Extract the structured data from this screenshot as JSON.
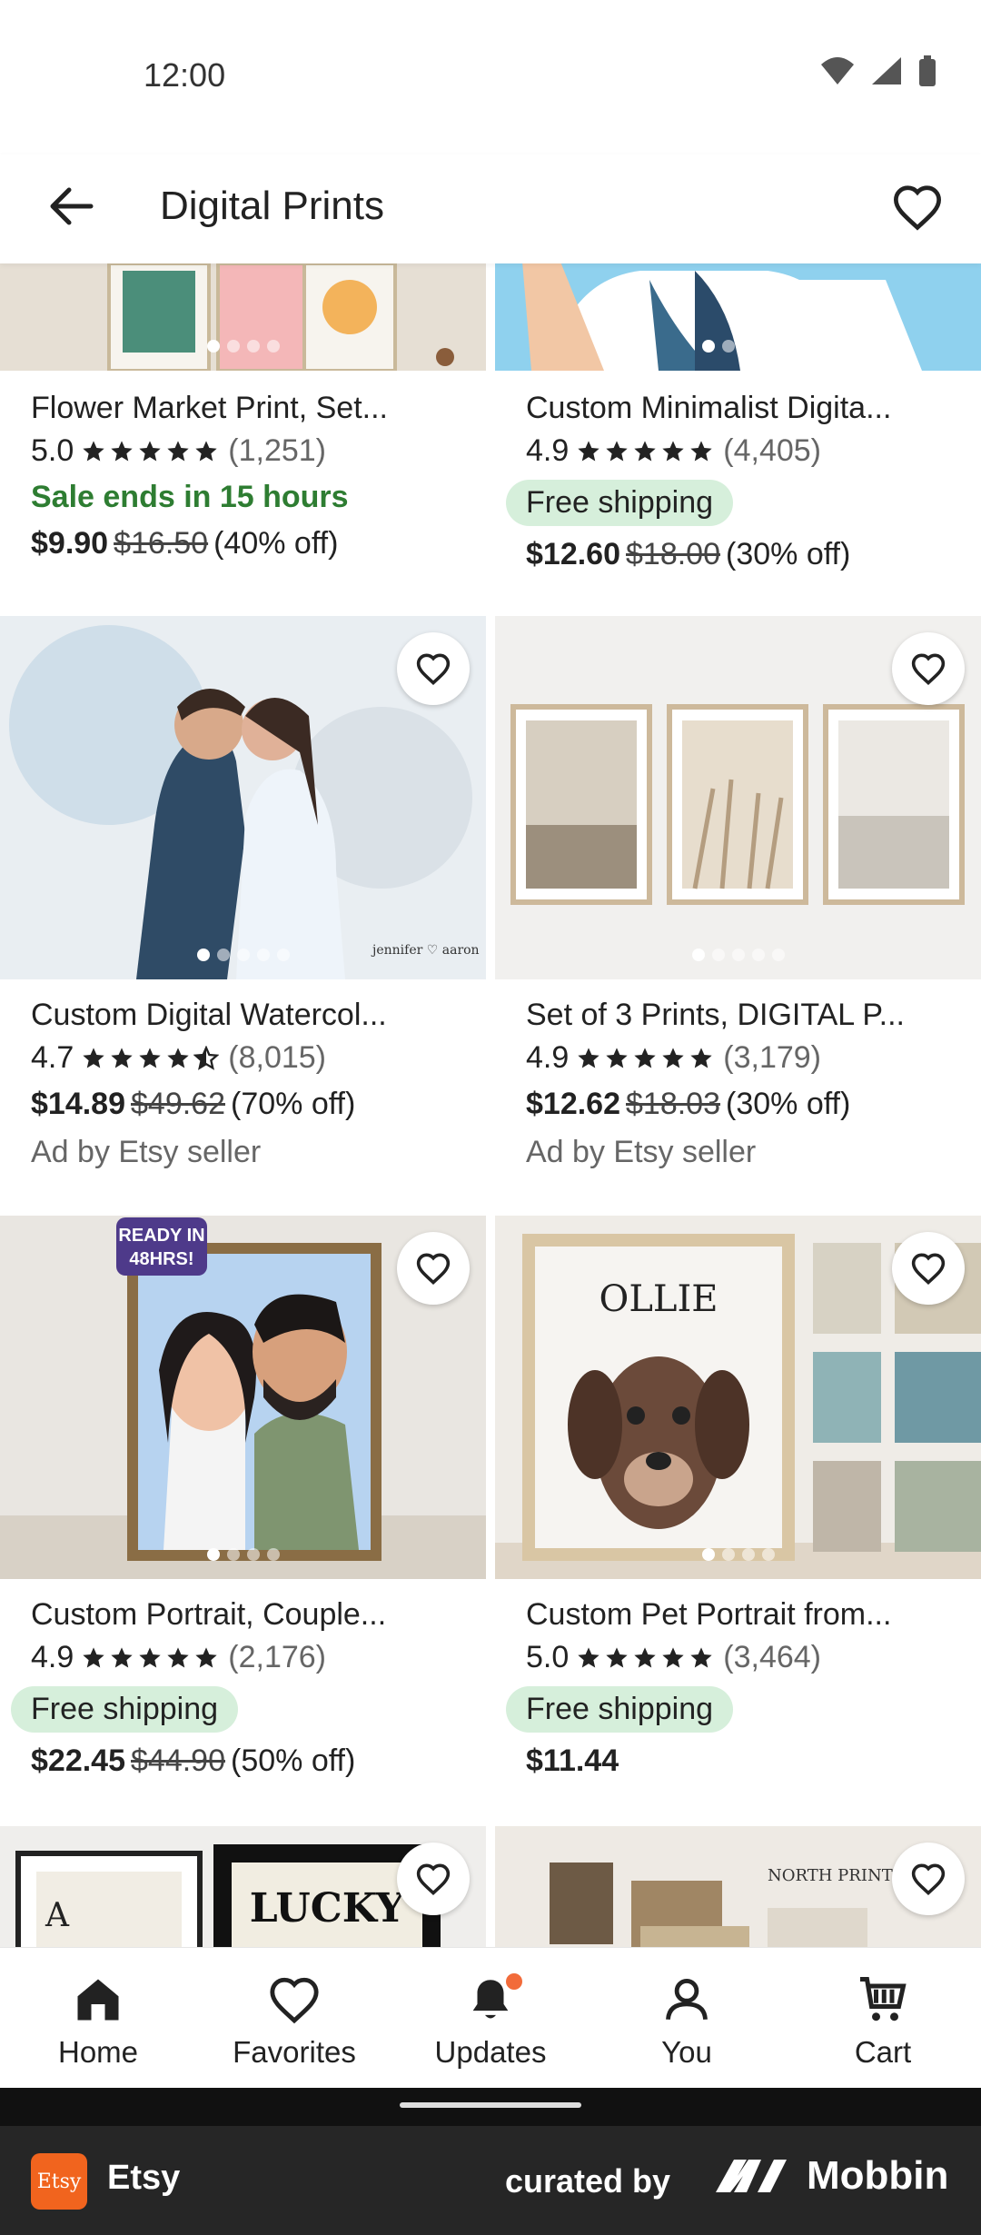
{
  "status": {
    "time": "12:00"
  },
  "app_bar": {
    "title": "Digital Prints"
  },
  "products": [
    {
      "title": "Flower Market Print, Set...",
      "rating": "5.0",
      "reviews": "(1,251)",
      "sale_text": "Sale ends in 15 hours",
      "price": "$9.90",
      "original_price": "$16.50",
      "discount": "(40% off)"
    },
    {
      "title": "Custom Minimalist Digita...",
      "rating": "4.9",
      "reviews": "(4,405)",
      "badge": "Free shipping",
      "price": "$12.60",
      "original_price": "$18.00",
      "discount": "(30% off)"
    },
    {
      "title": "Custom Digital Watercol...",
      "rating": "4.7",
      "reviews": "(8,015)",
      "price": "$14.89",
      "original_price": "$49.62",
      "discount": "(70% off)",
      "ad": "Ad by Etsy seller"
    },
    {
      "title": "Set of 3 Prints, DIGITAL P...",
      "rating": "4.9",
      "reviews": "(3,179)",
      "price": "$12.62",
      "original_price": "$18.03",
      "discount": "(30% off)",
      "ad": "Ad by Etsy seller"
    },
    {
      "title": "Custom Portrait, Couple...",
      "rating": "4.9",
      "reviews": "(2,176)",
      "badge": "Free shipping",
      "price": "$22.45",
      "original_price": "$44.90",
      "discount": "(50% off)",
      "image_text": "READY IN 48HRS!"
    },
    {
      "title": "Custom Pet Portrait from...",
      "rating": "5.0",
      "reviews": "(3,464)",
      "badge": "Free shipping",
      "price": "$11.44",
      "image_text": "OLLIE"
    },
    {
      "image_text": "LUCKY"
    },
    {
      "image_text": "NORTH PRINTS"
    }
  ],
  "nav": {
    "home": "Home",
    "favorites": "Favorites",
    "updates": "Updates",
    "you": "You",
    "cart": "Cart"
  },
  "footer": {
    "app": "Etsy",
    "logo": "Etsy",
    "curated": "curated by",
    "brand": "Mobbin"
  },
  "colors": {
    "accent": "#f1641e",
    "sale_green": "#2e7d32",
    "badge_bg": "#d6efdb"
  }
}
